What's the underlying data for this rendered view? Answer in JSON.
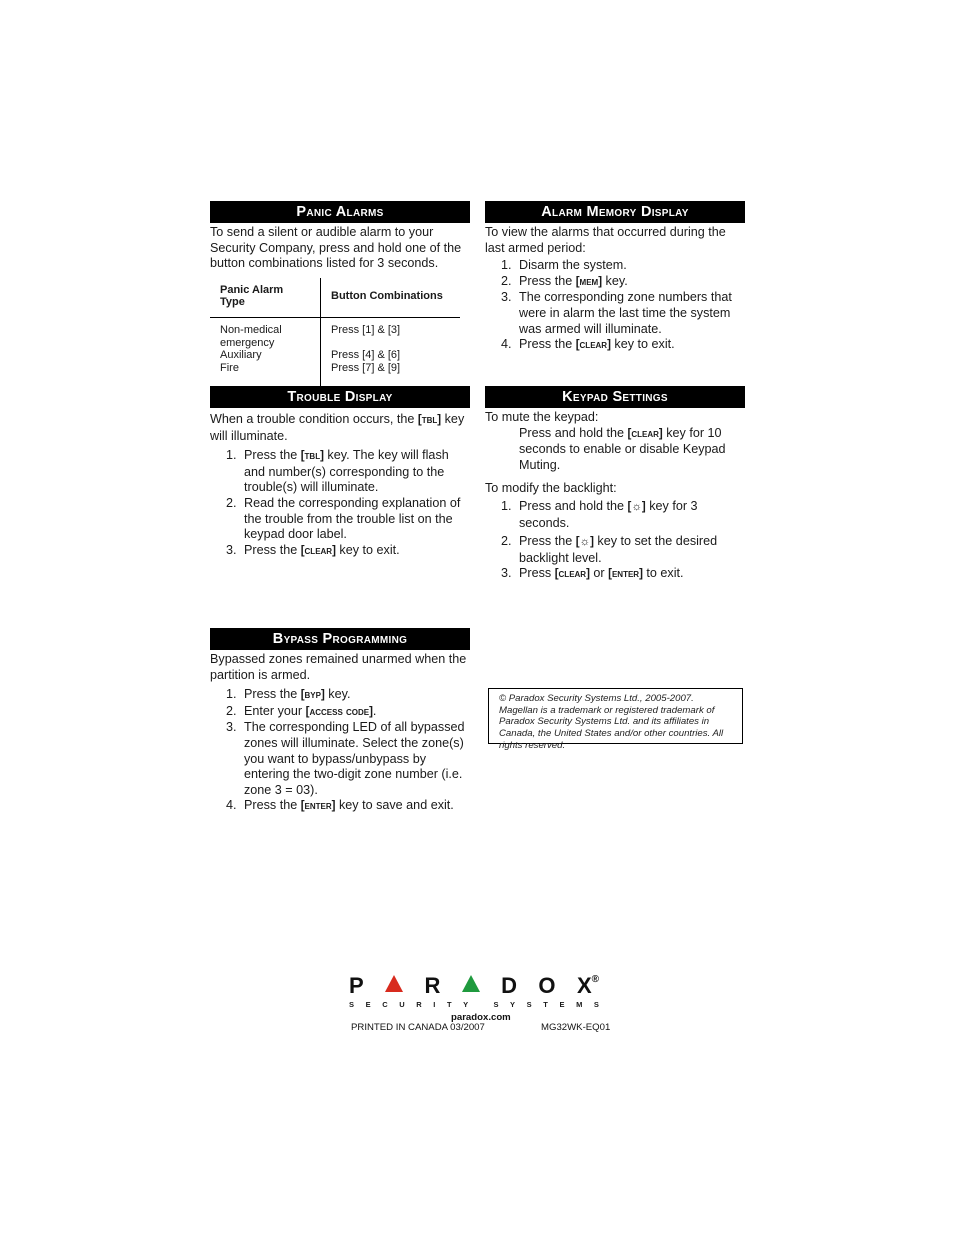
{
  "panic_alarms": {
    "title": "Panic Alarms",
    "intro": "To send a silent or audible alarm to your Security Company, press and hold one of the button combinations listed for 3 seconds.",
    "table": {
      "headers": [
        "Panic Alarm Type",
        "Button Combinations"
      ],
      "rows": [
        {
          "type": "Non-medical emergency",
          "combo": "Press [1] & [3]"
        },
        {
          "type": "Auxiliary",
          "combo": "Press [4] & [6]"
        },
        {
          "type": "Fire",
          "combo": "Press [7] & [9]"
        }
      ]
    }
  },
  "alarm_memory": {
    "title": "Alarm Memory Display",
    "intro": "To view the alarms that occurred during the last armed period:",
    "steps": [
      {
        "num": "1.",
        "pre": "Disarm the system.",
        "key": "",
        "post": ""
      },
      {
        "num": "2.",
        "pre": "Press the ",
        "key": "[MEM]",
        "post": " key."
      },
      {
        "num": "3.",
        "pre": "The corresponding zone numbers that were in alarm the last time the system was armed will illuminate.",
        "key": "",
        "post": ""
      },
      {
        "num": "4.",
        "pre": "Press the ",
        "key": "[CLEAR]",
        "post": " key to exit."
      }
    ]
  },
  "trouble_display": {
    "title": "Trouble Display",
    "intro_pre": "When a trouble condition occurs, the ",
    "intro_key": "[TBL]",
    "intro_post": " key will illuminate.",
    "steps": [
      {
        "num": "1.",
        "pre": "Press the ",
        "key": "[TBL]",
        "post": " key. The key will flash and number(s) corresponding to the trouble(s) will illuminate."
      },
      {
        "num": "2.",
        "pre": "Read the corresponding explanation of the trouble from the trouble list on the keypad door label.",
        "key": "",
        "post": ""
      },
      {
        "num": "3.",
        "pre": "Press the ",
        "key": "[CLEAR]",
        "post": " key to exit."
      }
    ]
  },
  "keypad_settings": {
    "title": "Keypad Settings",
    "mute_label": "To mute the keypad:",
    "mute_pre": "Press and hold the ",
    "mute_key": "[CLEAR]",
    "mute_post": " key for 10 seconds to enable or disable Keypad Muting.",
    "backlight_label": "To modify the backlight:",
    "steps": [
      {
        "num": "1.",
        "pre": "Press and hold the ",
        "key": "[☼]",
        "post": " key for 3 seconds."
      },
      {
        "num": "2.",
        "pre": "Press the ",
        "key": "[☼]",
        "post": " key to set the desired backlight level."
      },
      {
        "num": "3.",
        "pre": "Press ",
        "key": "[CLEAR]",
        "mid": " or ",
        "key2": "[ENTER]",
        "post": " to exit."
      }
    ]
  },
  "bypass_programming": {
    "title": "Bypass Programming",
    "intro": "Bypassed zones remained unarmed when the partition is armed.",
    "steps": [
      {
        "num": "1.",
        "pre": "Press the ",
        "key": "[BYP]",
        "post": " key."
      },
      {
        "num": "2.",
        "pre": "Enter your ",
        "key": "[ACCESS CODE]",
        "post": "."
      },
      {
        "num": "3.",
        "pre": "The corresponding LED of all bypassed zones will illuminate. Select the zone(s) you want to bypass/unbypass by entering the two-digit zone number (i.e. zone 3 = 03).",
        "key": "",
        "post": ""
      },
      {
        "num": "4.",
        "pre": "Press the ",
        "key": "[ENTER]",
        "post": " key to save and exit."
      }
    ]
  },
  "copyright": "© Paradox Security Systems Ltd., 2005-2007. Magellan is a trademark or registered trademark of Paradox Security Systems Ltd. and its affiliates in Canada, the United States and/or other countries. All rights reserved.",
  "logo": {
    "letters": [
      "P",
      "▲",
      "R",
      "▲",
      "D",
      "O",
      "X"
    ],
    "registered": "®",
    "sub1": [
      "S",
      "E",
      "C",
      "U",
      "R",
      "I",
      "T",
      "Y"
    ],
    "sub2": [
      "S",
      "Y",
      "S",
      "T",
      "E",
      "M",
      "S"
    ],
    "colors": {
      "red": "#d82b1e",
      "green": "#1f9a3e"
    }
  },
  "footer": {
    "website": "paradox.com",
    "printed": "PRINTED IN CANADA 03/2007",
    "code": "MG32WK-EQ01"
  }
}
